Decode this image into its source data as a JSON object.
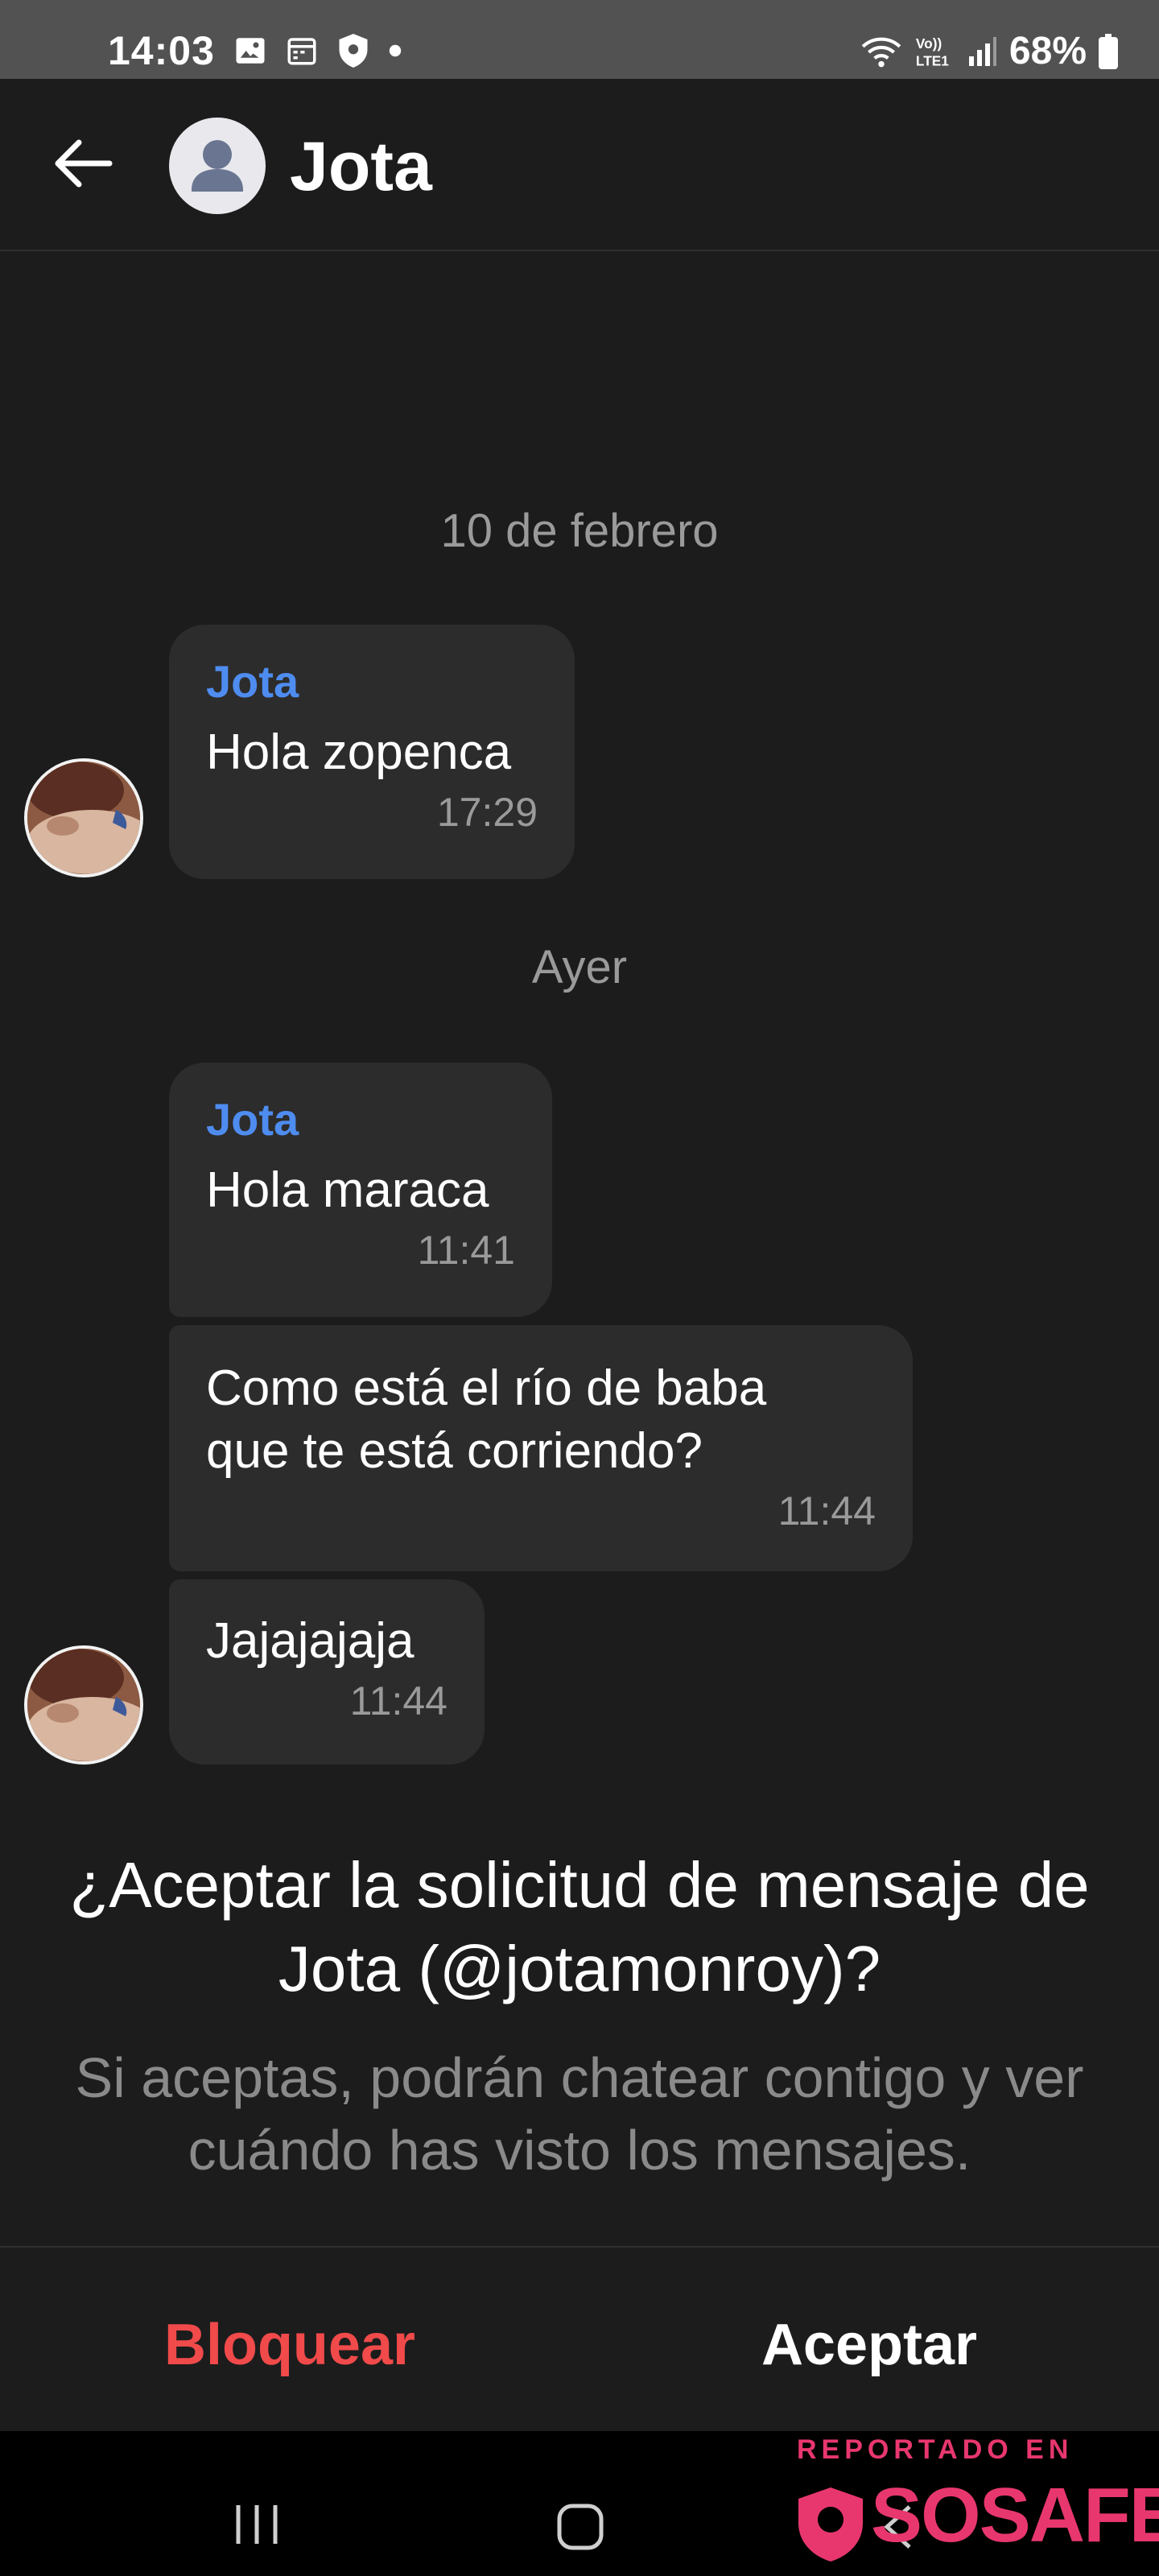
{
  "status_bar": {
    "time": "14:03",
    "battery": "68%",
    "left_icons": [
      "image-icon",
      "calendar-icon",
      "shield-icon",
      "dot-icon"
    ],
    "right_icons": [
      "wifi-icon",
      "volte-icon",
      "signal-icon",
      "battery-icon"
    ]
  },
  "header": {
    "contact_name": "Jota",
    "back_icon": "arrow-left-icon",
    "avatar_icon": "person-icon"
  },
  "chat": {
    "groups": [
      {
        "date": "10 de febrero",
        "messages": [
          {
            "sender": "Jota",
            "text": "Hola zopenca",
            "time": "17:29"
          }
        ]
      },
      {
        "date": "Ayer",
        "messages": [
          {
            "sender": "Jota",
            "text": "Hola maraca",
            "time": "11:41"
          },
          {
            "sender": "",
            "text": "Como está el río de baba que te está corriendo?",
            "time": "11:44"
          },
          {
            "sender": "",
            "text": "Jajajajaja",
            "time": "11:44"
          }
        ]
      }
    ]
  },
  "request": {
    "title": "¿Aceptar la solicitud de mensaje de Jota (@jotamonroy)?",
    "subtitle": "Si aceptas, podrán chatear contigo y ver cuándo has visto los mensajes.",
    "block_label": "Bloquear",
    "accept_label": "Aceptar"
  },
  "watermark": {
    "top_text": "REPORTADO EN",
    "brand": "SOSAFE"
  },
  "colors": {
    "background": "#1c1c1c",
    "bubble": "#2c2c2c",
    "sender_name": "#4e8cf0",
    "block": "#f04a4a",
    "watermark": "#e8376e"
  }
}
